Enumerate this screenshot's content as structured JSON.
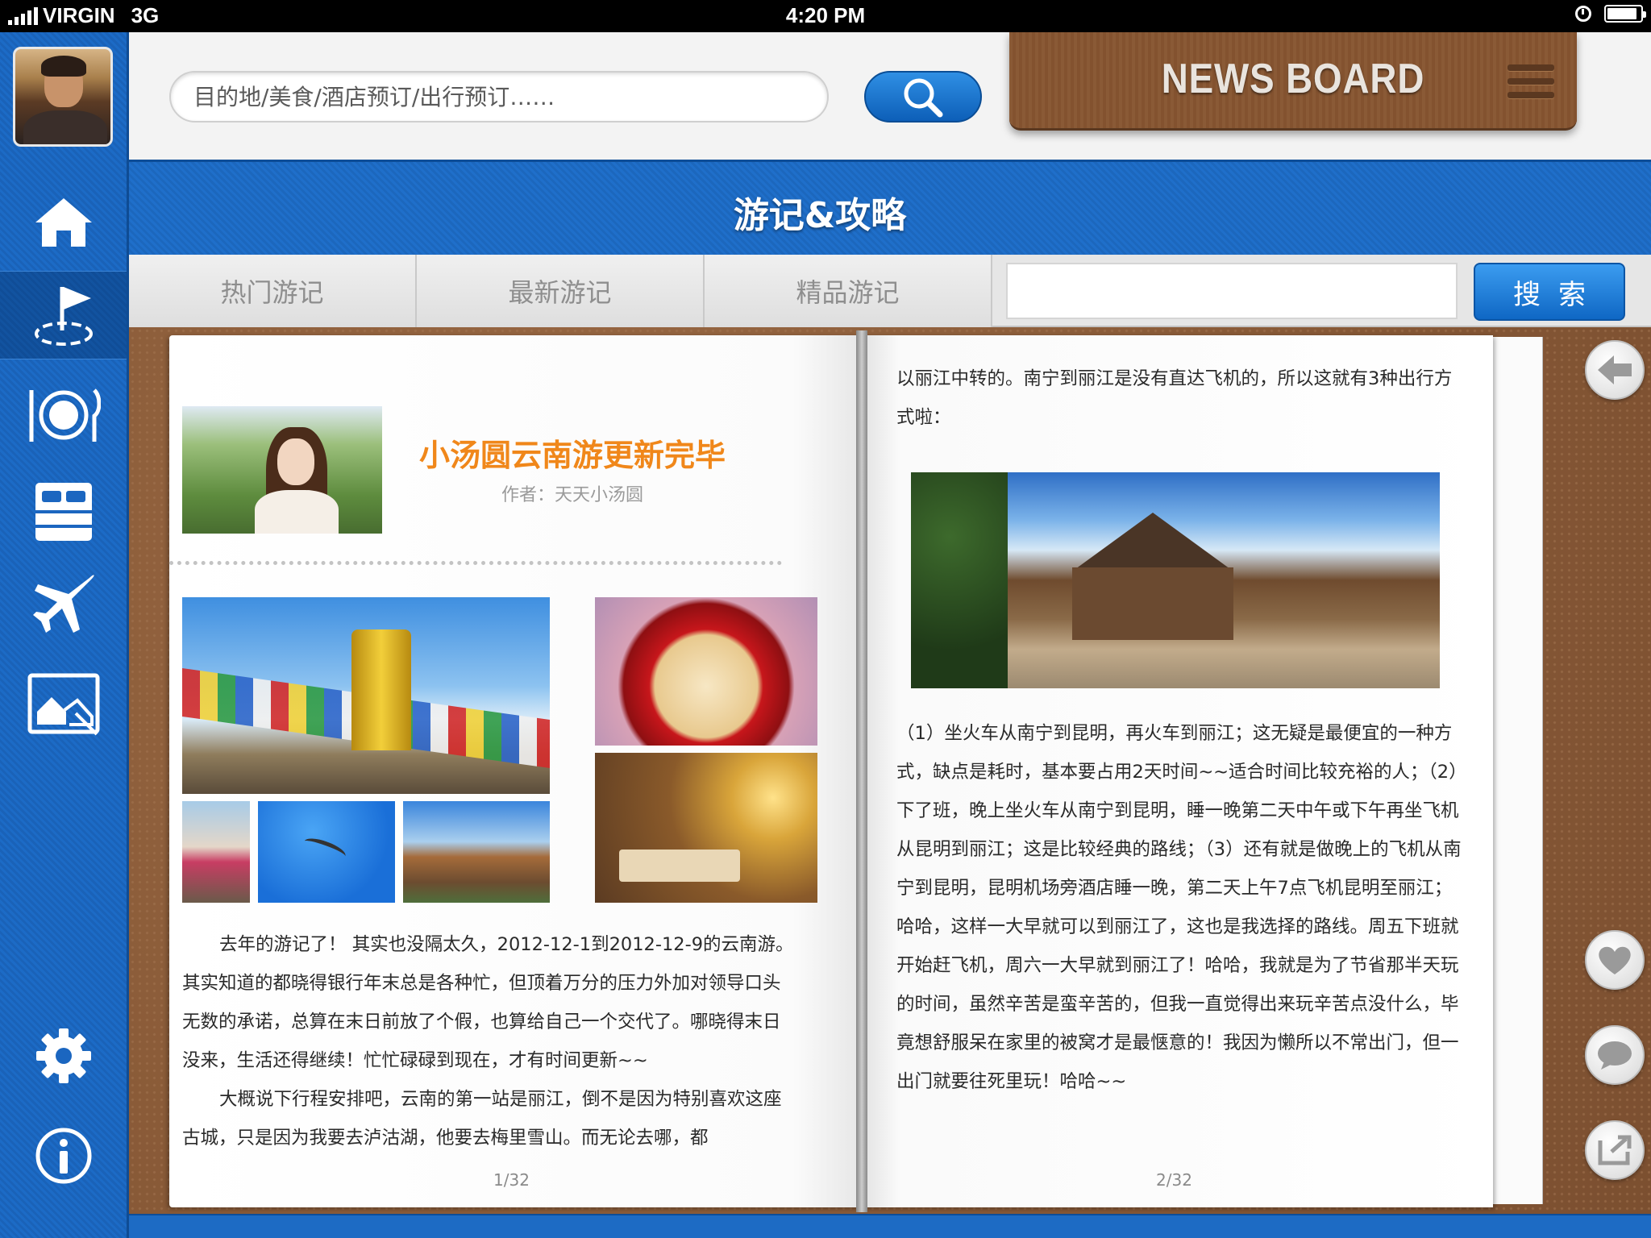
{
  "status_bar": {
    "carrier": "VIRGIN",
    "network": "3G",
    "time": "4:20 PM"
  },
  "header": {
    "search": {
      "placeholder": "目的地/美食/酒店预订/出行预订……",
      "value": ""
    },
    "news_board_label": "NEWS BOARD"
  },
  "sidebar": {
    "items": [
      {
        "icon": "home-icon"
      },
      {
        "icon": "travel-flag-icon",
        "active": true
      },
      {
        "icon": "dining-icon"
      },
      {
        "icon": "hotel-bed-icon"
      },
      {
        "icon": "airplane-icon"
      },
      {
        "icon": "photo-gallery-icon"
      },
      {
        "icon": "settings-gear-icon"
      },
      {
        "icon": "info-icon"
      }
    ]
  },
  "section": {
    "title": "游记&攻略"
  },
  "tabs": {
    "items": [
      {
        "label": "热门游记"
      },
      {
        "label": "最新游记"
      },
      {
        "label": "精品游记"
      }
    ],
    "search_value": "",
    "search_button": "搜索"
  },
  "article": {
    "title": "小汤圆云南游更新完毕",
    "author": "作者：天天小汤圆",
    "left_paragraphs": [
      "去年的游记了！ 其实也没隔太久，2012-12-1到2012-12-9的云南游。其实知道的都晓得银行年末总是各种忙，但顶着万分的压力外加对领导口头无数的承诺，总算在末日前放了个假，也算给自己一个交代了。哪晓得末日没来，生活还得继续！忙忙碌碌到现在，才有时间更新~~",
      "大概说下行程安排吧，云南的第一站是丽江，倒不是因为特别喜欢这座古城，只是因为我要去泸沽湖，他要去梅里雪山。而无论去哪，都"
    ],
    "right_top": "以丽江中转的。南宁到丽江是没有直达飞机的，所以这就有3种出行方式啦：",
    "right_body": "（1）坐火车从南宁到昆明，再火车到丽江；这无疑是最便宜的一种方式，缺点是耗时，基本要占用2天时间~~适合时间比较充裕的人；（2）下了班，晚上坐火车从南宁到昆明，睡一晚第二天中午或下午再坐飞机从昆明到丽江；这是比较经典的路线；（3）还有就是做晚上的飞机从南宁到昆明，昆明机场旁酒店睡一晚，第二天上午7点飞机昆明至丽江；哈哈，这样一大早就可以到丽江了，这也是我选择的路线。周五下班就开始赶飞机，周六一大早就到丽江了！哈哈，我就是为了节省那半天玩的时间，虽然辛苦是蛮辛苦的，但我一直觉得出来玩辛苦点没什么，毕竟想舒服呆在家里的被窝才是最惬意的！我因为懒所以不常出门，但一出门就要往死里玩！哈哈~~",
    "page_left": "1/32",
    "page_right": "2/32"
  },
  "right_actions": [
    {
      "icon": "back-arrow-icon"
    },
    {
      "icon": "heart-icon"
    },
    {
      "icon": "comment-bubble-icon"
    },
    {
      "icon": "share-icon"
    }
  ],
  "colors": {
    "accent_blue": "#1d6bc4",
    "title_orange": "#f0871a",
    "leather": "#8a5b38"
  },
  "battery_level": 0.9
}
